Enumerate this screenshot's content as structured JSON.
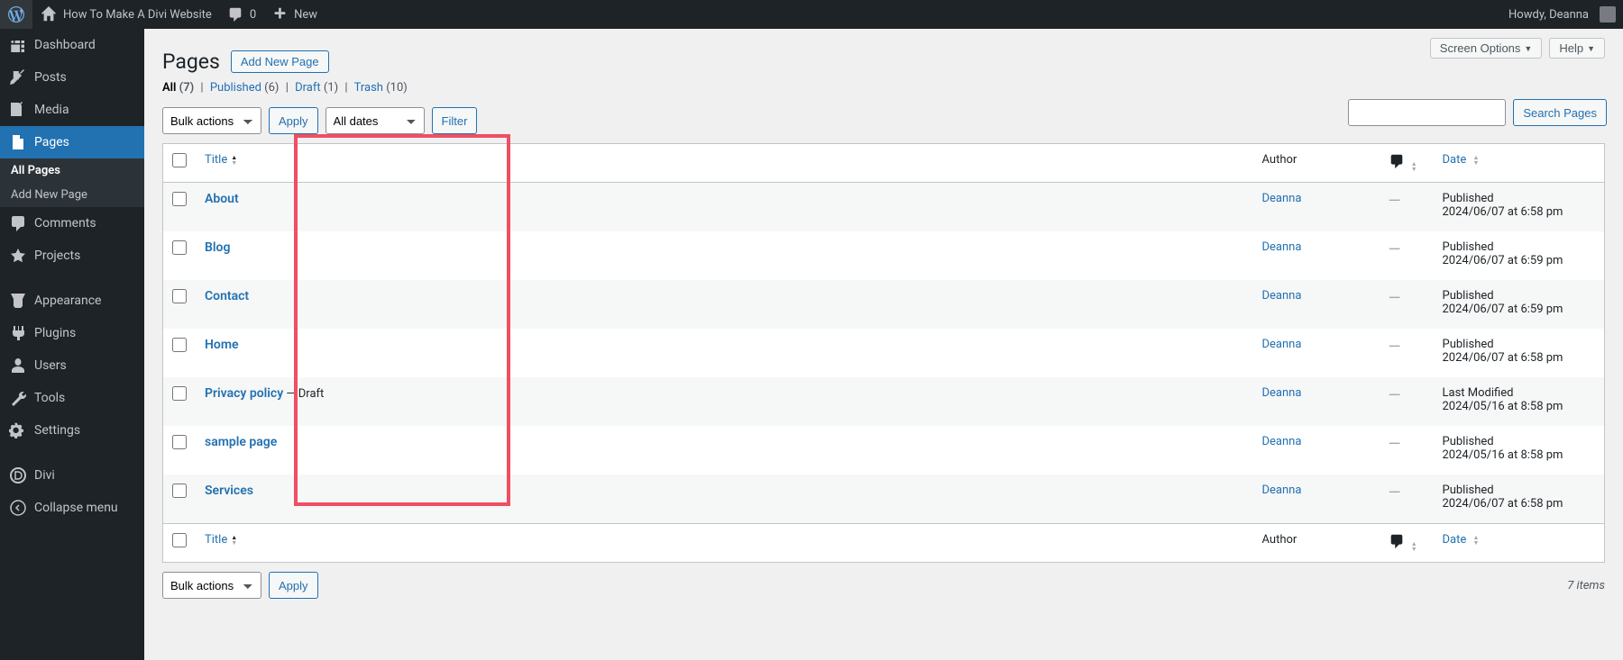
{
  "adminbar": {
    "site_name": "How To Make A Divi Website",
    "comments_count": "0",
    "new_label": "New",
    "howdy": "Howdy, Deanna"
  },
  "sidebar": {
    "items": [
      {
        "icon": "dashboard",
        "label": "Dashboard"
      },
      {
        "icon": "posts",
        "label": "Posts"
      },
      {
        "icon": "media",
        "label": "Media"
      },
      {
        "icon": "pages",
        "label": "Pages",
        "current": true
      },
      {
        "icon": "comments",
        "label": "Comments"
      },
      {
        "icon": "projects",
        "label": "Projects"
      },
      {
        "icon": "sep"
      },
      {
        "icon": "appearance",
        "label": "Appearance"
      },
      {
        "icon": "plugins",
        "label": "Plugins"
      },
      {
        "icon": "users",
        "label": "Users"
      },
      {
        "icon": "tools",
        "label": "Tools"
      },
      {
        "icon": "settings",
        "label": "Settings"
      },
      {
        "icon": "sep"
      },
      {
        "icon": "divi",
        "label": "Divi"
      },
      {
        "icon": "collapse",
        "label": "Collapse menu"
      }
    ],
    "submenu": [
      {
        "label": "All Pages",
        "current": true
      },
      {
        "label": "Add New Page"
      }
    ]
  },
  "screen_meta": {
    "screen_options": "Screen Options",
    "help": "Help"
  },
  "heading": {
    "title": "Pages",
    "add_new": "Add New Page"
  },
  "views": {
    "all": {
      "label": "All",
      "count": "(7)"
    },
    "published": {
      "label": "Published",
      "count": "(6)"
    },
    "draft": {
      "label": "Draft",
      "count": "(1)"
    },
    "trash": {
      "label": "Trash",
      "count": "(10)"
    }
  },
  "search": {
    "button": "Search Pages"
  },
  "tablenav": {
    "bulk": "Bulk actions",
    "apply": "Apply",
    "dates": "All dates",
    "filter": "Filter",
    "displaying": "7 items"
  },
  "columns": {
    "title": "Title",
    "author": "Author",
    "date": "Date"
  },
  "rows": [
    {
      "title": "About",
      "suffix": "",
      "author": "Deanna",
      "comments": "—",
      "status": "Published",
      "date": "2024/06/07 at 6:58 pm"
    },
    {
      "title": "Blog",
      "suffix": "",
      "author": "Deanna",
      "comments": "—",
      "status": "Published",
      "date": "2024/06/07 at 6:59 pm"
    },
    {
      "title": "Contact",
      "suffix": "",
      "author": "Deanna",
      "comments": "—",
      "status": "Published",
      "date": "2024/06/07 at 6:59 pm"
    },
    {
      "title": "Home",
      "suffix": "",
      "author": "Deanna",
      "comments": "—",
      "status": "Published",
      "date": "2024/06/07 at 6:58 pm"
    },
    {
      "title": "Privacy policy",
      "suffix": " — Draft",
      "author": "Deanna",
      "comments": "—",
      "status": "Last Modified",
      "date": "2024/05/16 at 8:58 pm"
    },
    {
      "title": "sample page",
      "suffix": "",
      "author": "Deanna",
      "comments": "—",
      "status": "Published",
      "date": "2024/05/16 at 8:58 pm"
    },
    {
      "title": "Services",
      "suffix": "",
      "author": "Deanna",
      "comments": "—",
      "status": "Published",
      "date": "2024/06/07 at 6:58 pm"
    }
  ]
}
